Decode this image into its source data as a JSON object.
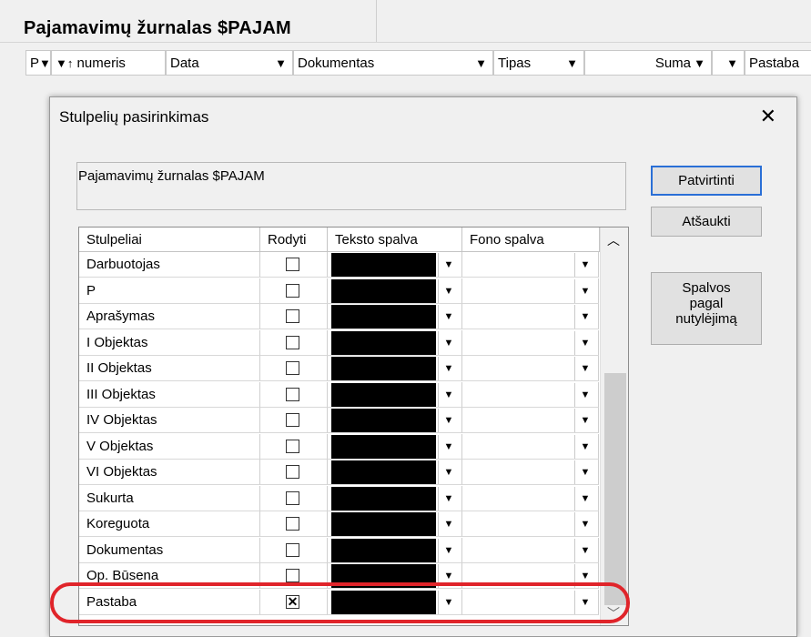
{
  "background": {
    "title": "Pajamavimų žurnalas $PAJAM",
    "columns": [
      {
        "label": "P",
        "arrow": "▼"
      },
      {
        "label": "numeris",
        "arrow": "▼↑"
      },
      {
        "label": "Data",
        "arrow": "▼"
      },
      {
        "label": "Dokumentas",
        "arrow": "▼"
      },
      {
        "label": "Tipas",
        "arrow": "▼"
      },
      {
        "label": "Suma",
        "arrow": "▼"
      },
      {
        "label": "",
        "arrow": "▼"
      },
      {
        "label": "Pastaba",
        "arrow": ""
      }
    ]
  },
  "dialog": {
    "title": "Stulpelių pasirinkimas",
    "close_glyph": "✕",
    "journal_name": "Pajamavimų žurnalas $PAJAM",
    "buttons": {
      "confirm": "Patvirtinti",
      "cancel": "Atšaukti",
      "default_colors_1": "Spalvos",
      "default_colors_2": "pagal",
      "default_colors_3": "nutylėjimą"
    },
    "grid": {
      "headers": [
        "Stulpeliai",
        "Rodyti",
        "Teksto spalva",
        "Fono spalva"
      ],
      "rows": [
        {
          "name": "Darbuotojas",
          "checked": false
        },
        {
          "name": "P",
          "checked": false
        },
        {
          "name": "Aprašymas",
          "checked": false
        },
        {
          "name": "I Objektas",
          "checked": false
        },
        {
          "name": "II Objektas",
          "checked": false
        },
        {
          "name": "III Objektas",
          "checked": false
        },
        {
          "name": "IV Objektas",
          "checked": false
        },
        {
          "name": "V Objektas",
          "checked": false
        },
        {
          "name": "VI Objektas",
          "checked": false
        },
        {
          "name": "Sukurta",
          "checked": false
        },
        {
          "name": "Koreguota",
          "checked": false
        },
        {
          "name": "Dokumentas",
          "checked": false
        },
        {
          "name": "Op. Būsena",
          "checked": false
        },
        {
          "name": "Pastaba",
          "checked": true
        }
      ]
    },
    "colors": {
      "text_color": "#000000",
      "background_color": "#ffffff",
      "highlight": "#e0242a",
      "accent": "#2a6fd6"
    }
  }
}
